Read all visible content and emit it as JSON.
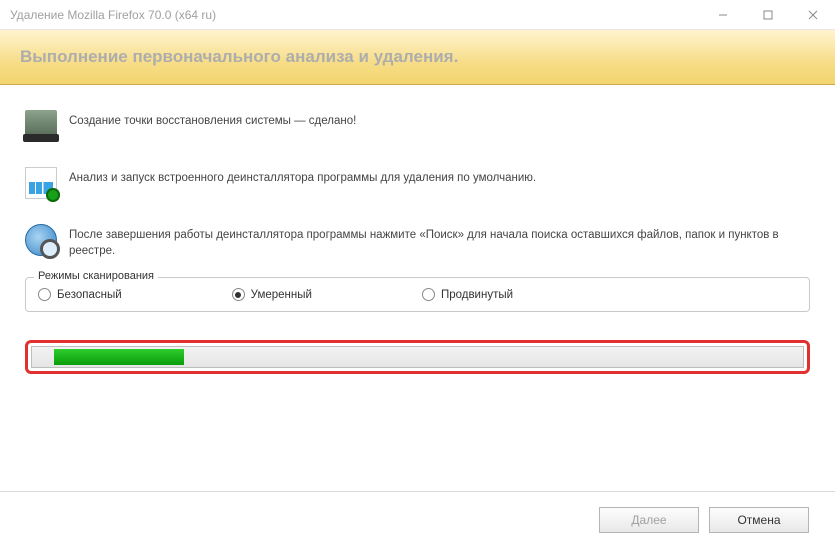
{
  "window": {
    "title": "Удаление Mozilla Firefox 70.0 (x64 ru)"
  },
  "banner": {
    "title": "Выполнение первоначального анализа и удаления."
  },
  "steps": {
    "backup": "Создание точки восстановления системы — сделано!",
    "analyze": "Анализ и запуск встроенного деинсталлятора программы для удаления по умолчанию.",
    "search": "После завершения работы деинсталлятора программы нажмите «Поиск» для начала поиска оставшихся файлов, папок и пунктов в реестре."
  },
  "modes": {
    "legend": "Режимы сканирования",
    "safe": "Безопасный",
    "moderate": "Умеренный",
    "advanced": "Продвинутый",
    "selected": "moderate"
  },
  "progress": {
    "percent": 18
  },
  "footer": {
    "next": "Далее",
    "cancel": "Отмена"
  }
}
